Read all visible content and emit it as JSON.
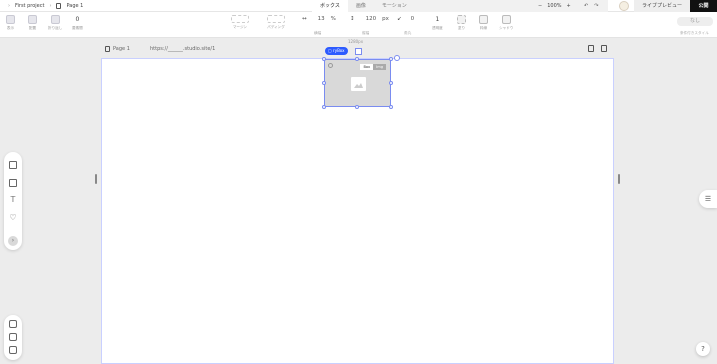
{
  "topbar": {
    "project": "First project",
    "page": "Page 1",
    "tabs": [
      "ボックス",
      "画像",
      "モーション"
    ],
    "zoom": "100%",
    "zoom_minus": "−",
    "zoom_plus": "+",
    "undo": "↶",
    "redo": "↷",
    "live_preview": "ライブプレビュー",
    "publish": "公開"
  },
  "toolbar": {
    "labels": {
      "display": "表示",
      "layout": "配置",
      "wrap": "折り返し",
      "gap": "要素間",
      "margin": "マージン",
      "padding": "パディング",
      "width": "横幅",
      "height": "縦幅",
      "rotate": "角丸",
      "opacity": "透明度",
      "fill": "塗り",
      "border": "枠線",
      "shadow": "シャドウ"
    },
    "gap_value": "0",
    "width_value": "13",
    "width_unit": "%",
    "height_value": "120",
    "height_unit": "px",
    "radius_value": "0",
    "opacity_value": "1",
    "width_icon": "↔",
    "height_icon": "↕",
    "radius_icon": "↙",
    "none_button": "なし",
    "style_label": "条件付きスタイル"
  },
  "canvas": {
    "dims": "1280px",
    "page_name": "Page 1",
    "url": "https://______.studio.site/1",
    "selected_tag": "▢ ryBox",
    "inner_tabs": [
      "Box",
      "Img"
    ]
  },
  "panels": {
    "text_tool": "T",
    "heart_tool": "♡",
    "more": "›",
    "right_toggle": "☰",
    "help": "?"
  }
}
